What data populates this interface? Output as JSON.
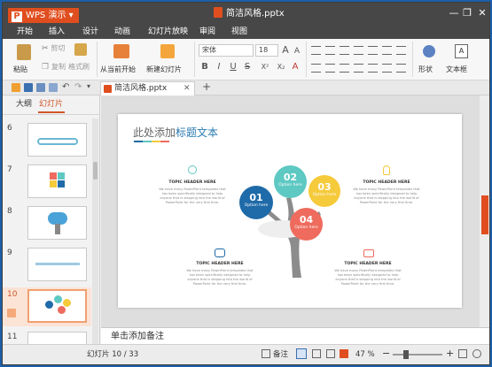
{
  "app": {
    "name": "WPS 演示",
    "logo": "P",
    "doc_title": "简洁风格.pptx"
  },
  "menu": [
    "开始",
    "插入",
    "设计",
    "动画",
    "幻灯片放映",
    "审阅",
    "视图"
  ],
  "ribbon": {
    "paste": "粘贴",
    "cut": "剪切",
    "copy": "复制",
    "format_painter": "格式刷",
    "from_current": "从当前开始",
    "new_slide": "新建幻灯片",
    "font_name": "宋体",
    "font_size": "18",
    "shape": "形状",
    "textbox": "文本框",
    "bold": "B",
    "italic": "I",
    "underline": "U",
    "strike": "S",
    "superscript": "X²",
    "subscript": "X₂",
    "clear": "A"
  },
  "doc_tab": {
    "title": "简洁风格.pptx",
    "add": "+"
  },
  "left_panel": {
    "tab_outline": "大纲",
    "tab_slides": "幻灯片",
    "thumbnails": [
      "6",
      "7",
      "8",
      "9",
      "10",
      "11"
    ],
    "selected": "10"
  },
  "slide": {
    "title_prefix": "此处添加",
    "title_accent": "标题文本",
    "bubbles": [
      {
        "num": "01",
        "sub": "Option here",
        "color": "#1f6aa8"
      },
      {
        "num": "02",
        "sub": "Option here",
        "color": "#5ec8c2"
      },
      {
        "num": "03",
        "sub": "Option here",
        "color": "#f5ca3b"
      },
      {
        "num": "04",
        "sub": "Option here",
        "color": "#ee6b5d"
      }
    ],
    "topic_header": "TOPIC HEADER HERE",
    "topic_body": "We have many PowerPoint templates that has been specifically designed to help anyone that is stepping into the world of PowerPoint for the very first time.",
    "topic_body_lines": [
      "We have many PowerPoint templates that",
      "has been specifically designed to help",
      "anyone that is stepping into the world of",
      "PowerPoint for the very first time."
    ],
    "icons": [
      "clock-icon",
      "bulb-icon",
      "network-icon",
      "camera-icon"
    ],
    "accent_colors": [
      "#1f6aa8",
      "#5ec8c2",
      "#f5ca3b",
      "#ee6b5d"
    ]
  },
  "notes_placeholder": "单击添加备注",
  "status": {
    "slide_info": "幻灯片 10 / 33",
    "notes": "备注",
    "zoom": "47 %"
  }
}
